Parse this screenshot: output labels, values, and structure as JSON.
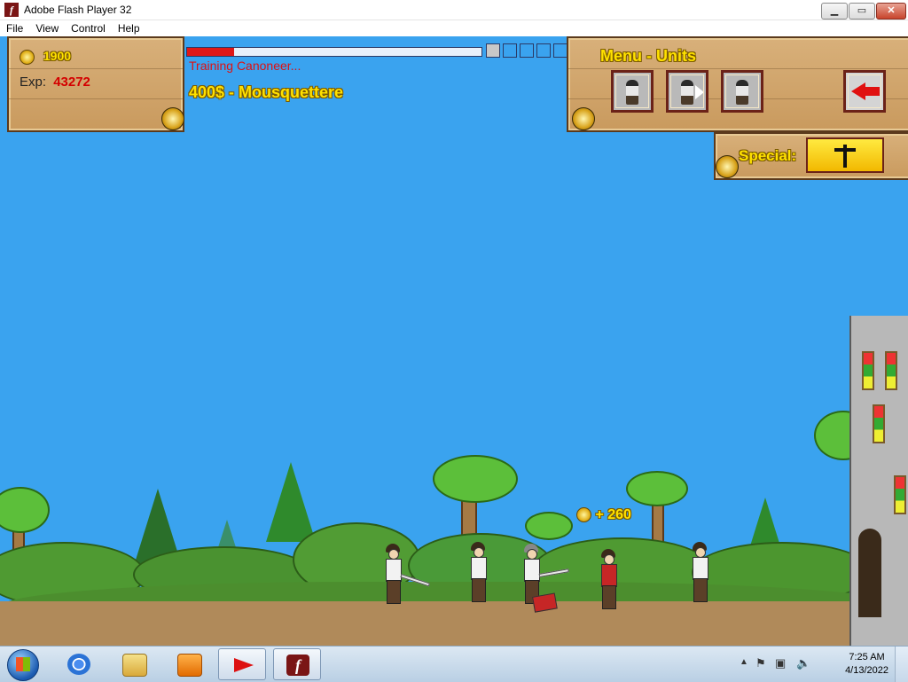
{
  "window": {
    "title": "Adobe Flash Player 32",
    "minimize": "▁",
    "maximize": "▭",
    "close": "✕"
  },
  "menu": [
    "File",
    "View",
    "Control",
    "Help"
  ],
  "hud": {
    "gold": "1900",
    "exp_label": "Exp:",
    "exp_value": "43272",
    "training_text": "Training Canoneer...",
    "training_progress": 0.16,
    "queue_slots": 5,
    "queue_filled": 1,
    "unit_cost_text": "400$ - Mousquettere",
    "menu_title": "Menu - Units",
    "special_label": "Special:",
    "reward_text": "+ 260"
  },
  "units": [
    {
      "name": "swordsman"
    },
    {
      "name": "mousquettere"
    },
    {
      "name": "canoneer"
    }
  ],
  "taskbar": {
    "apps": [
      "start",
      "chrome",
      "explorer",
      "media-player",
      "pdf-reader",
      "flash-player"
    ],
    "time": "7:25 AM",
    "date": "4/13/2022"
  },
  "colors": {
    "sky": "#3aa3ef",
    "hud_yellow": "#ffe100",
    "exp_red": "#d40000",
    "training_red": "#e01010"
  }
}
